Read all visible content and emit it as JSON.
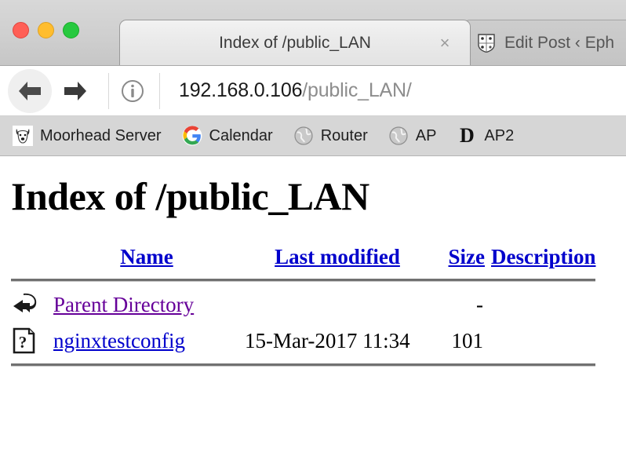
{
  "window": {
    "traffic_lights": [
      {
        "name": "close",
        "color": "#ff5f56"
      },
      {
        "name": "minimize",
        "color": "#ffbd2e"
      },
      {
        "name": "maximize",
        "color": "#27c93f"
      }
    ]
  },
  "tabs": [
    {
      "title": "Index of /public_LAN",
      "active": true,
      "close_label": "×",
      "favicon": "none"
    },
    {
      "title": "Edit Post ‹ Eph",
      "active": false,
      "favicon": "shield-crest-icon"
    }
  ],
  "toolbar": {
    "back_icon": "back-arrow-icon",
    "forward_icon": "forward-arrow-icon",
    "info_icon": "info-circle-icon",
    "url_host": "192.168.0.106",
    "url_path": "/public_LAN/"
  },
  "bookmarks": [
    {
      "label": "Moorhead Server",
      "icon": "dog-face-icon"
    },
    {
      "label": "Calendar",
      "icon": "google-g-icon"
    },
    {
      "label": "Router",
      "icon": "globe-icon"
    },
    {
      "label": "AP",
      "icon": "globe-icon"
    },
    {
      "label": "AP2",
      "icon": "letter-d-icon",
      "icon_text": "D"
    }
  ],
  "page": {
    "heading": "Index of /public_LAN",
    "columns": {
      "name": "Name",
      "last_modified": "Last modified",
      "size": "Size",
      "description": "Description"
    },
    "rows": [
      {
        "icon": "parent-directory-icon",
        "name": "Parent Directory",
        "link_state": "visited",
        "last_modified": "",
        "size": "-",
        "description": ""
      },
      {
        "icon": "unknown-file-icon",
        "name": "nginxtestconfig",
        "link_state": "unvisited",
        "last_modified": "15-Mar-2017 11:34",
        "size": "101",
        "description": ""
      }
    ]
  },
  "colors": {
    "link_unvisited": "#0000cc",
    "link_visited": "#660099",
    "chrome_tabstrip": "#cfcfcf",
    "bookmarks_bar": "#d6d6d6"
  }
}
